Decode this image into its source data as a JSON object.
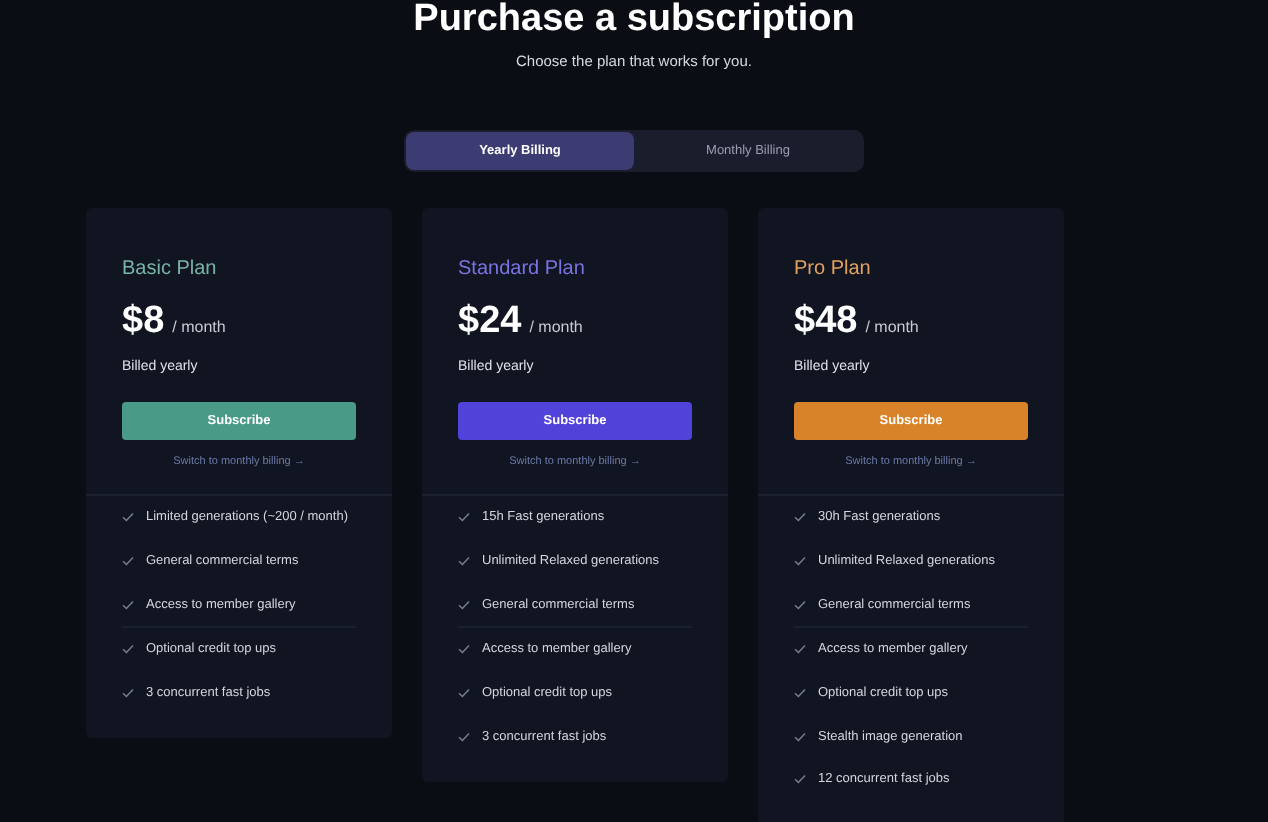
{
  "header": {
    "title": "Purchase a subscription",
    "subtitle": "Choose the plan that works for you."
  },
  "billing_tabs": [
    {
      "label": "Yearly Billing",
      "selected": true
    },
    {
      "label": "Monthly Billing",
      "selected": false
    }
  ],
  "plans": [
    {
      "name": "Basic Plan",
      "color": "#4a9a88",
      "price": "$8",
      "period": "/ month",
      "billing": "Billed yearly",
      "button": "Subscribe",
      "link": "Switch to monthly billing →",
      "features": [
        "Limited generations (~200 / month)",
        "General commercial terms",
        "Access to member gallery",
        "Optional credit top ups",
        "3 concurrent fast jobs"
      ]
    },
    {
      "name": "Standard Plan",
      "color": "#5143d9",
      "price": "$24",
      "period": "/ month",
      "billing": "Billed yearly",
      "button": "Subscribe",
      "link": "Switch to monthly billing →",
      "features": [
        "15h Fast generations",
        "Unlimited Relaxed generations",
        "General commercial terms",
        "Access to member gallery",
        "Optional credit top ups",
        "3 concurrent fast jobs"
      ]
    },
    {
      "name": "Pro Plan",
      "color": "#d8832a",
      "price": "$48",
      "period": "/ month",
      "billing": "Billed yearly",
      "button": "Subscribe",
      "link": "Switch to monthly billing →",
      "features": [
        "30h Fast generations",
        "Unlimited Relaxed generations",
        "General commercial terms",
        "Access to member gallery",
        "Optional credit top ups",
        "Stealth image generation",
        "12 concurrent fast jobs"
      ]
    }
  ]
}
